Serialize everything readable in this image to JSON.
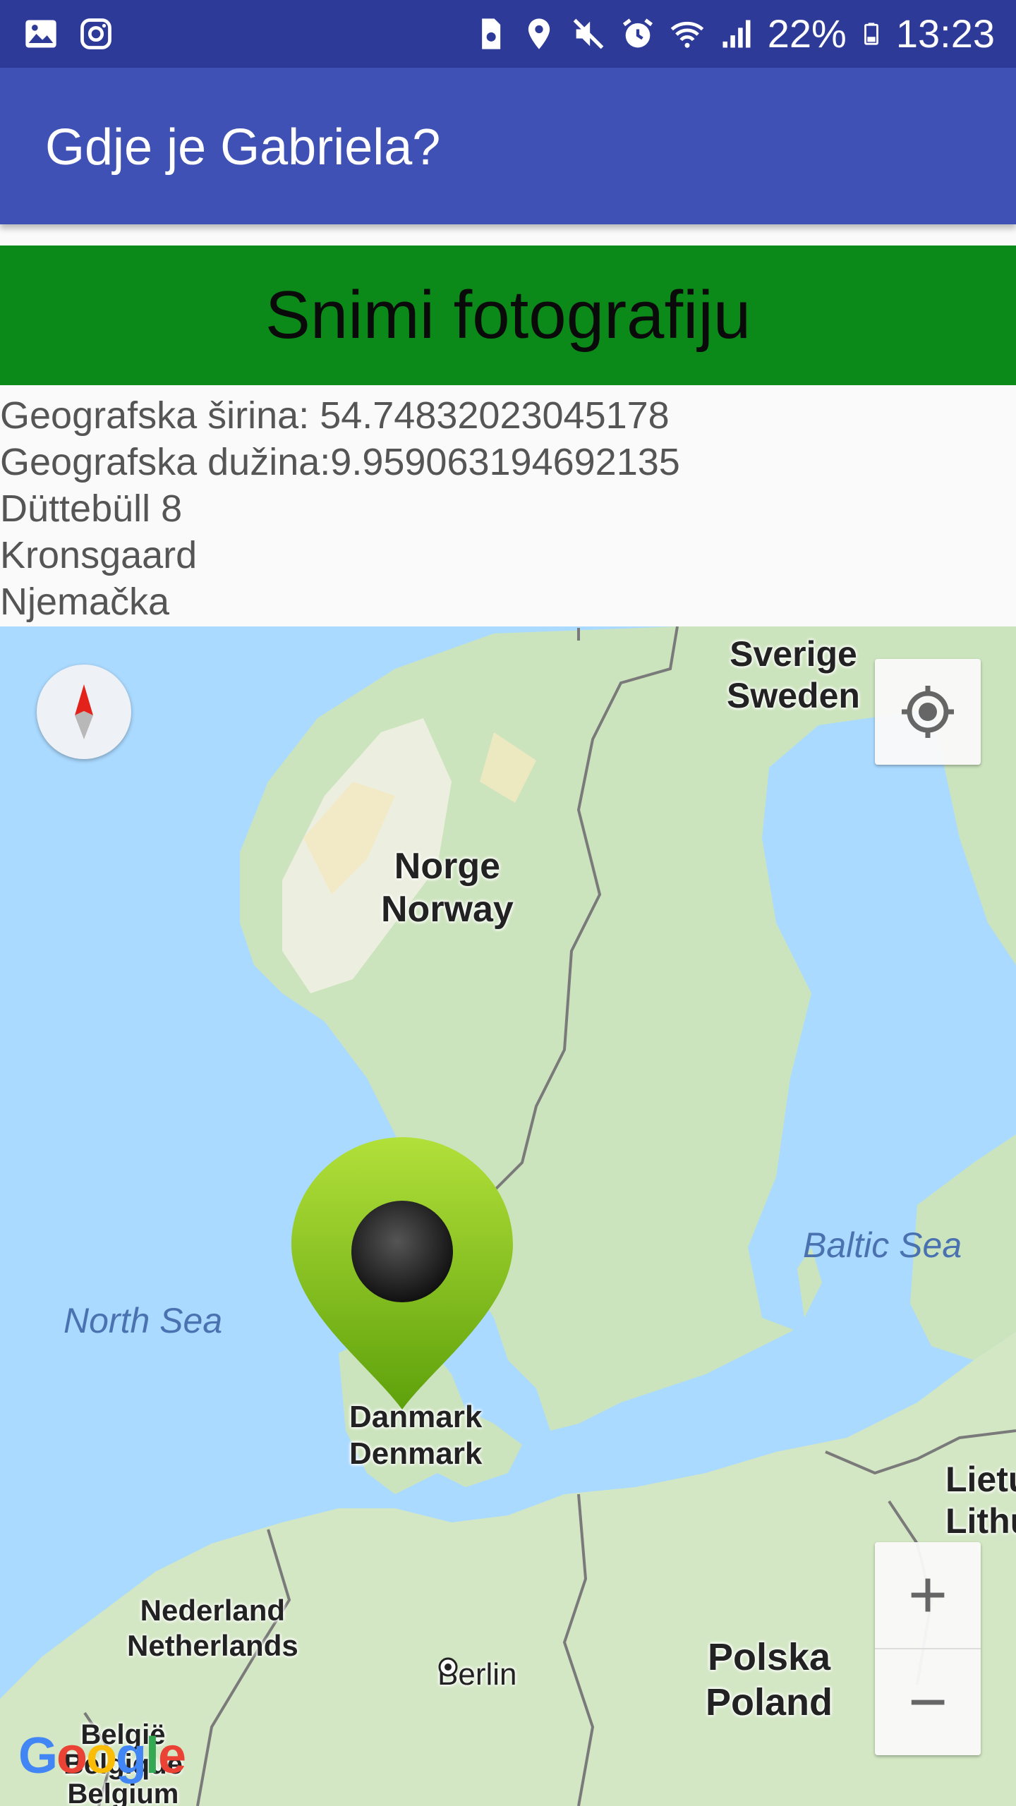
{
  "status_bar": {
    "battery": "22%",
    "time": "13:23",
    "icons": [
      "gallery-icon",
      "instagram-icon",
      "storage-icon",
      "location-icon",
      "mute-icon",
      "alarm-icon",
      "wifi-icon",
      "signal-icon",
      "battery-icon"
    ]
  },
  "app_bar": {
    "title": "Gdje je Gabriela?"
  },
  "capture_button": {
    "label": "Snimi fotografiju",
    "color": "#0b8a1a"
  },
  "location": {
    "latitude": "Geografska širina: 54.74832023045178",
    "longitude": "Geografska dužina:9.959063194692135",
    "street": "Düttebüll 8",
    "city": "Kronsgaard",
    "country": "Njemačka"
  },
  "map": {
    "labels": {
      "sweden": [
        "Sverige",
        "Sweden"
      ],
      "norway": [
        "Norge",
        "Norway"
      ],
      "denmark": [
        "Danmark",
        "Denmark"
      ],
      "lithuania": [
        "Lietuva",
        "Lithuania"
      ],
      "netherlands": [
        "Nederland",
        "Netherlands"
      ],
      "poland": [
        "Polska",
        "Poland"
      ],
      "belgium": [
        "België",
        "Belgique",
        "Belgium"
      ],
      "berlin": "Berlin"
    },
    "water": {
      "north_sea": "North Sea",
      "baltic_sea": "Baltic Sea"
    },
    "zoom_in": "+",
    "zoom_out": "−",
    "logo": "Google",
    "marker_color": "#8cc63f"
  }
}
